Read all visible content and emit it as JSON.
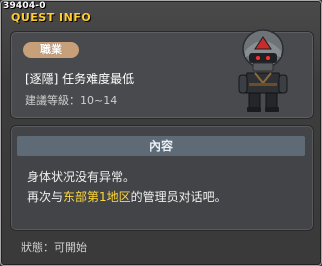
{
  "window": {
    "quest_id": "39404-0",
    "title": "QUEST INFO"
  },
  "quest": {
    "job_badge": "職業",
    "name": "[逐隱] 任务难度最低",
    "level_label": "建議等級：",
    "level_value": "10~14"
  },
  "content": {
    "header": "內容",
    "line1": "身体状况没有异常。",
    "line2_prefix": "再次与",
    "line2_highlight": "东部第1地区",
    "line2_suffix": "的管理员对话吧。"
  },
  "status": {
    "label": "狀態：",
    "value": "可開始"
  },
  "colors": {
    "title": "#ffcc33",
    "badge": "#c7a07a",
    "highlight": "#ffd83a",
    "content_header": "#5e6b77"
  },
  "icons": {
    "npc_portrait": "armored-soldier-portrait"
  }
}
